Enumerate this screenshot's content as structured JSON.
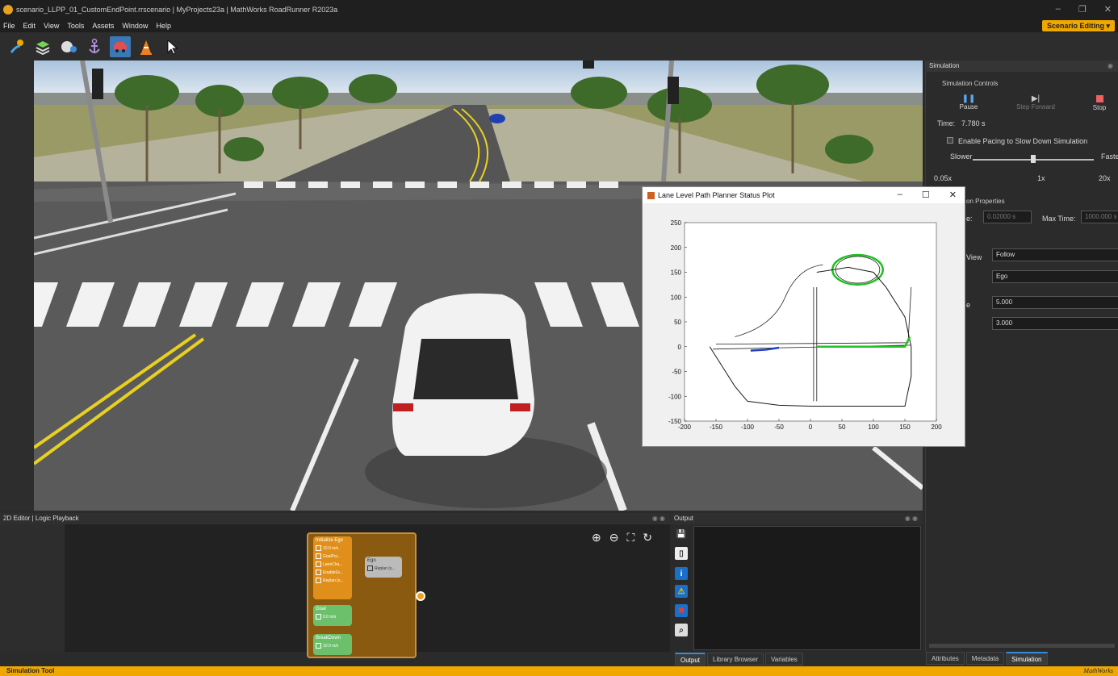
{
  "window": {
    "title": "scenario_LLPP_01_CustomEndPoint.rrscenario | MyProjects23a | MathWorks RoadRunner R2023a",
    "min": "–",
    "max": "❐",
    "close": "✕"
  },
  "menu": [
    "File",
    "Edit",
    "View",
    "Tools",
    "Assets",
    "Window",
    "Help"
  ],
  "mode": "Scenario Editing",
  "simulation": {
    "panel_title": "Simulation",
    "controls_group": "Simulation Controls",
    "pause": "Pause",
    "step_forward": "Step Forward",
    "stop": "Stop",
    "time_label": "Time:",
    "time_value": "7.780 s",
    "pacing_label": "Enable Pacing to Slow Down Simulation",
    "slower": "Slower",
    "faster": "Faster",
    "speed_min": "0.05x",
    "speed_mid": "1x",
    "speed_max": "20x",
    "props_group": "on Properties",
    "step_label": "e:",
    "step_value": "0.02000 s",
    "max_time_label": "Max Time:",
    "max_time_value": "1000.000 s",
    "view_label": "View",
    "view_value": "Follow",
    "actor_value": "Ego",
    "dist_label": "e",
    "field1": "5.000",
    "field2": "3.000"
  },
  "right_tabs": [
    "Attributes",
    "Metadata",
    "Simulation"
  ],
  "plot_window": {
    "title": "Lane Level Path Planner Status Plot",
    "min": "–",
    "max": "☐",
    "close": "✕"
  },
  "chart_data": {
    "type": "line",
    "title": "",
    "xlabel": "",
    "ylabel": "",
    "xlim": [
      -200,
      200
    ],
    "ylim": [
      -150,
      250
    ],
    "xticks": [
      "-200",
      "-150",
      "-100",
      "-50",
      "0",
      "50",
      "100",
      "150",
      "200"
    ],
    "yticks": [
      "250",
      "200",
      "150",
      "100",
      "50",
      "0",
      "-50",
      "-100",
      "-150"
    ],
    "grid": false,
    "series": [
      {
        "color": "#1a1a1a",
        "x": [
          -160,
          -140,
          -120,
          -100,
          -50,
          0,
          50,
          100,
          150,
          160,
          160,
          150,
          120,
          100,
          60,
          10
        ],
        "y": [
          0,
          -40,
          -80,
          -110,
          -118,
          -120,
          -120,
          -120,
          -120,
          -60,
          0,
          60,
          120,
          150,
          160,
          150
        ]
      },
      {
        "color": "#22c022",
        "x": [
          10,
          40,
          80,
          120,
          150,
          158
        ],
        "y": [
          0,
          0,
          0,
          0,
          0,
          20
        ]
      },
      {
        "color": "#1f3fc8",
        "x": [
          -95,
          -70,
          -50
        ],
        "y": [
          -8,
          -6,
          -2
        ]
      }
    ]
  },
  "editor": {
    "title": "2D Editor | Logic Playback",
    "initialize": "Initialize Ego",
    "init_speed": "10.0 m/s",
    "init_goal": "GoalPoi...",
    "init_lane": "LaneCha...",
    "init_enable": "EnableGr...",
    "init_replan": "Replan (s...",
    "ego": "Ego",
    "ego_replan": "Replan (s...",
    "goal": "Goal",
    "goal_speed": "0.0 m/s",
    "breakdown": "BreakDown",
    "breakdown_speed": "10.0 m/s"
  },
  "output": {
    "title": "Output"
  },
  "output_tabs": [
    "Output",
    "Library Browser",
    "Variables"
  ],
  "status": {
    "left": "Simulation Tool",
    "brand": "MathWorks"
  }
}
